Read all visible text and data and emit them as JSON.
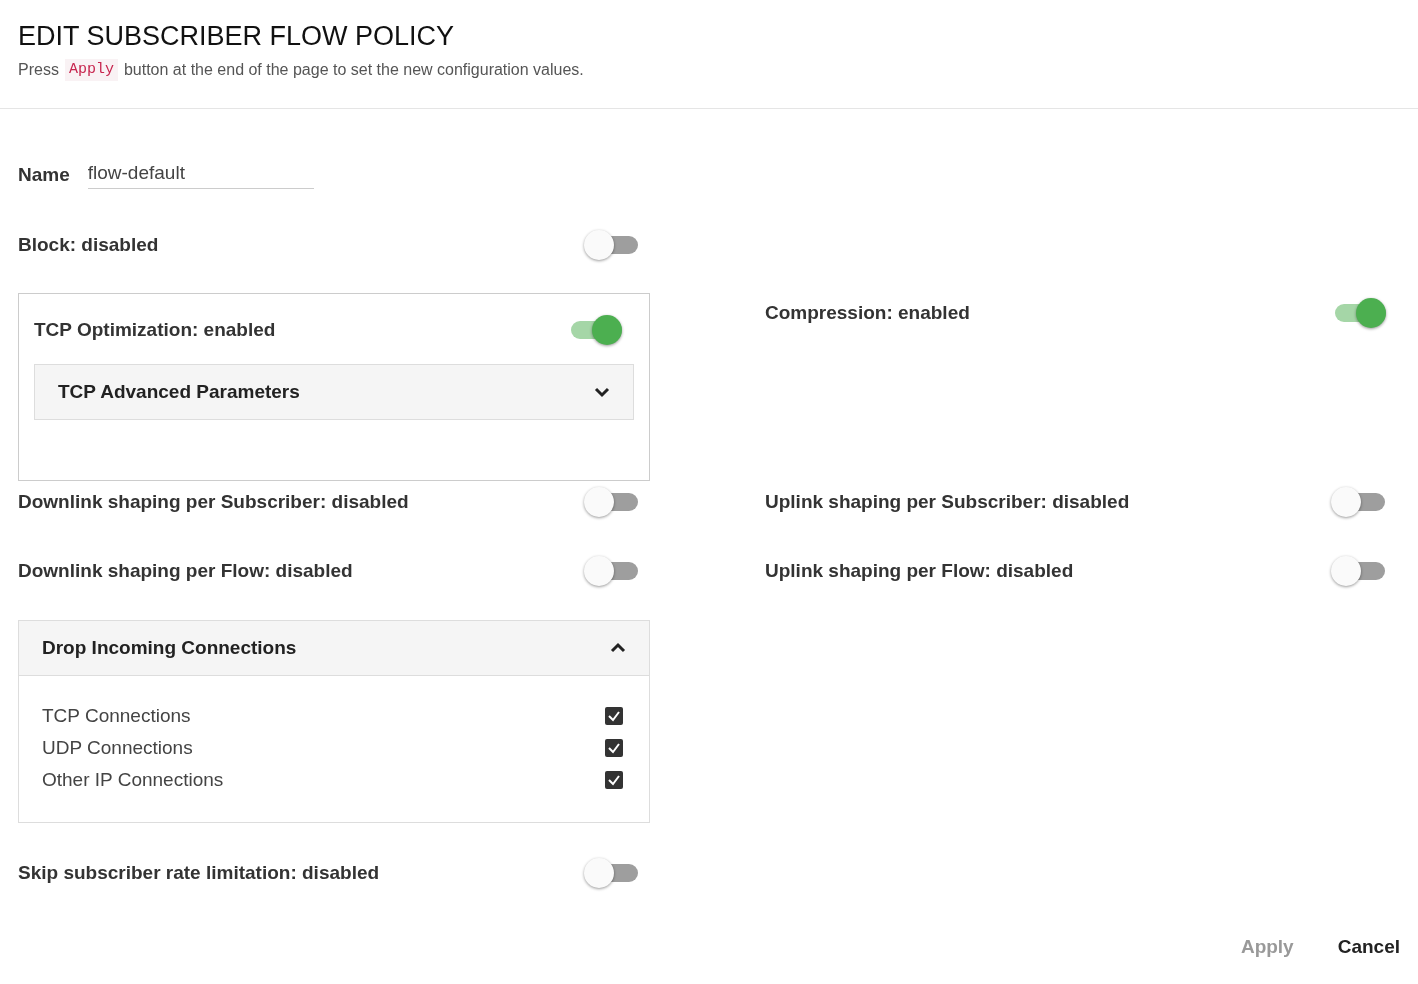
{
  "header": {
    "title": "EDIT SUBSCRIBER FLOW POLICY",
    "hint_before": "Press",
    "hint_code": "Apply",
    "hint_after": "button at the end of the page to set the new configuration values."
  },
  "name_field": {
    "label": "Name",
    "value": "flow-default"
  },
  "block": {
    "label": "Block: disabled",
    "on": false
  },
  "tcp_optimization": {
    "label": "TCP Optimization: enabled",
    "on": true,
    "advanced": {
      "title": "TCP Advanced Parameters",
      "expanded": false
    }
  },
  "compression": {
    "label": "Compression: enabled",
    "on": true
  },
  "shaping": [
    {
      "downlink": {
        "label": "Downlink shaping per Subscriber: disabled",
        "on": false
      },
      "uplink": {
        "label": "Uplink shaping per Subscriber: disabled",
        "on": false
      }
    },
    {
      "downlink": {
        "label": "Downlink shaping per Flow: disabled",
        "on": false
      },
      "uplink": {
        "label": "Uplink shaping per Flow: disabled",
        "on": false
      }
    }
  ],
  "drop_incoming": {
    "title": "Drop Incoming Connections",
    "expanded": true,
    "items": [
      {
        "label": "TCP Connections",
        "checked": true
      },
      {
        "label": "UDP Connections",
        "checked": true
      },
      {
        "label": "Other IP Connections",
        "checked": true
      }
    ]
  },
  "skip_rate_limitation": {
    "label": "Skip subscriber rate limitation: disabled",
    "on": false
  },
  "buttons": [
    {
      "label": "Apply",
      "disabled": true
    },
    {
      "label": "Cancel",
      "disabled": false
    }
  ]
}
